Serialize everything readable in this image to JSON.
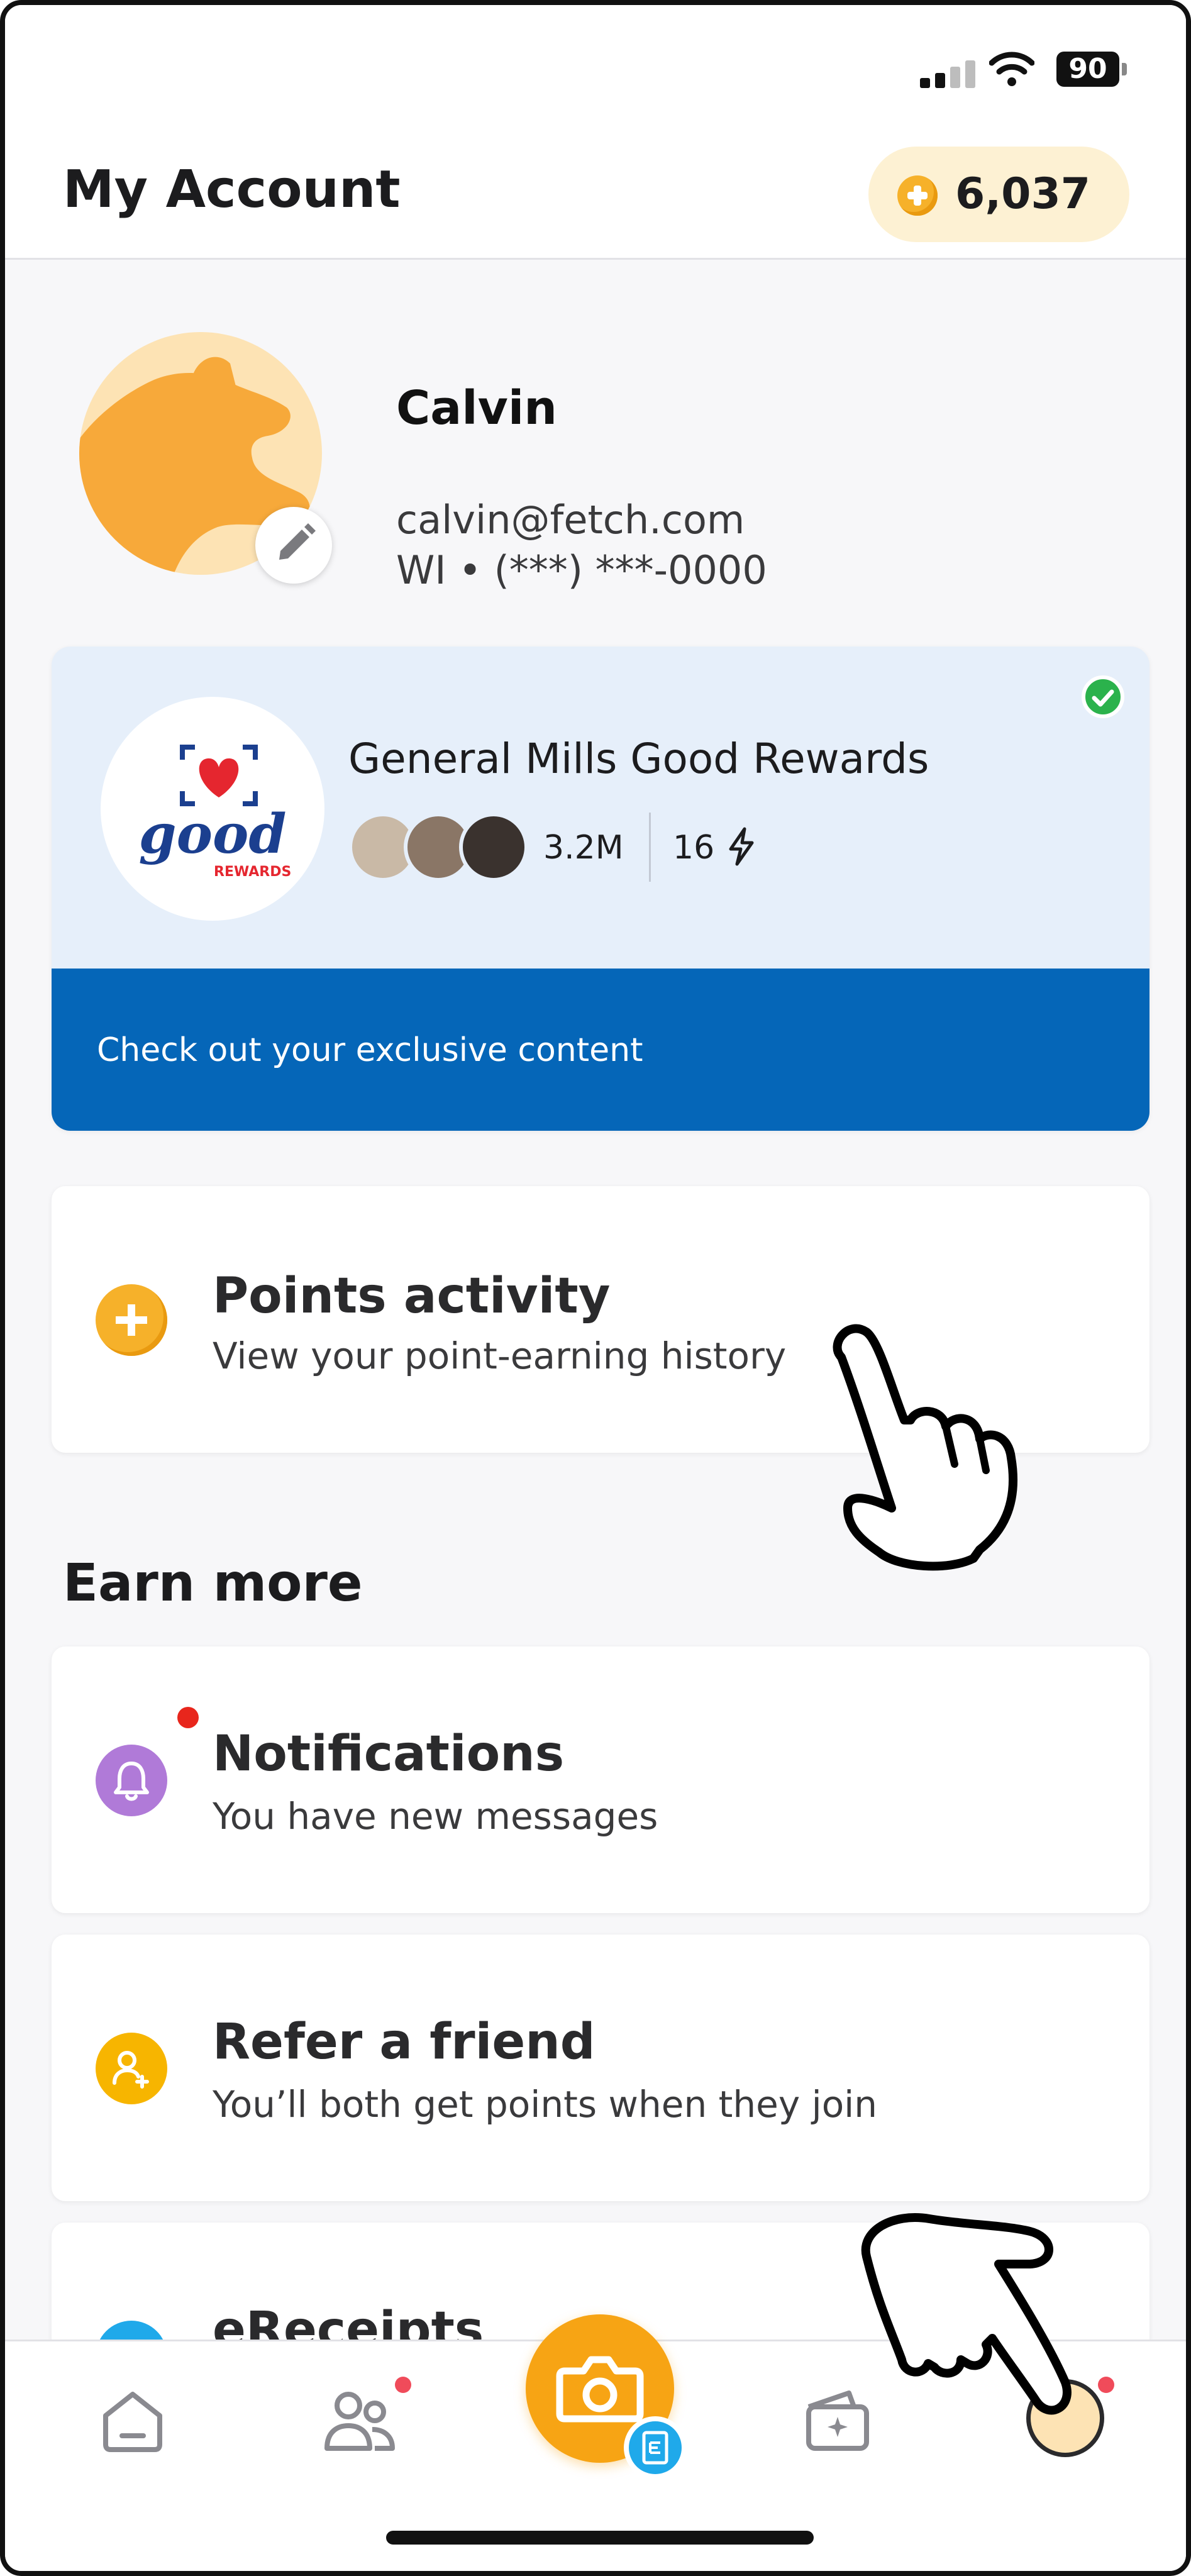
{
  "status_bar": {
    "battery": "90"
  },
  "header": {
    "title": "My Account",
    "points": "6,037"
  },
  "profile": {
    "name": "Calvin",
    "email": "calvin@fetch.com",
    "location_phone": "WI • (***) ***-0000"
  },
  "rewards_club": {
    "title": "General Mills Good Rewards",
    "logo_text": "good",
    "logo_subtext": "REWARDS",
    "members": "3.2M",
    "streak": "16",
    "cta": "Check out your exclusive content"
  },
  "points_activity": {
    "title": "Points activity",
    "subtitle": "View your point-earning history"
  },
  "earn_more": {
    "section_title": "Earn more",
    "items": [
      {
        "title": "Notifications",
        "subtitle": "You have new messages",
        "icon": "bell-icon",
        "color": "#b07ad8"
      },
      {
        "title": "Refer a friend",
        "subtitle": "You’ll both get points when they join",
        "icon": "add-user-icon",
        "color": "#f7b500"
      },
      {
        "title": "eReceipts",
        "icon": "receipt-icon",
        "color": "#1fa9ea"
      }
    ]
  },
  "tab_bar": {
    "items": [
      "home-icon",
      "friends-icon",
      "camera-icon",
      "rewards-icon",
      "account-icon"
    ]
  },
  "colors": {
    "brand_orange": "#f7a414",
    "rewards_blue": "#0566b8",
    "points_pill_bg": "#fdf1d3",
    "verified_green": "#2bb24c"
  }
}
